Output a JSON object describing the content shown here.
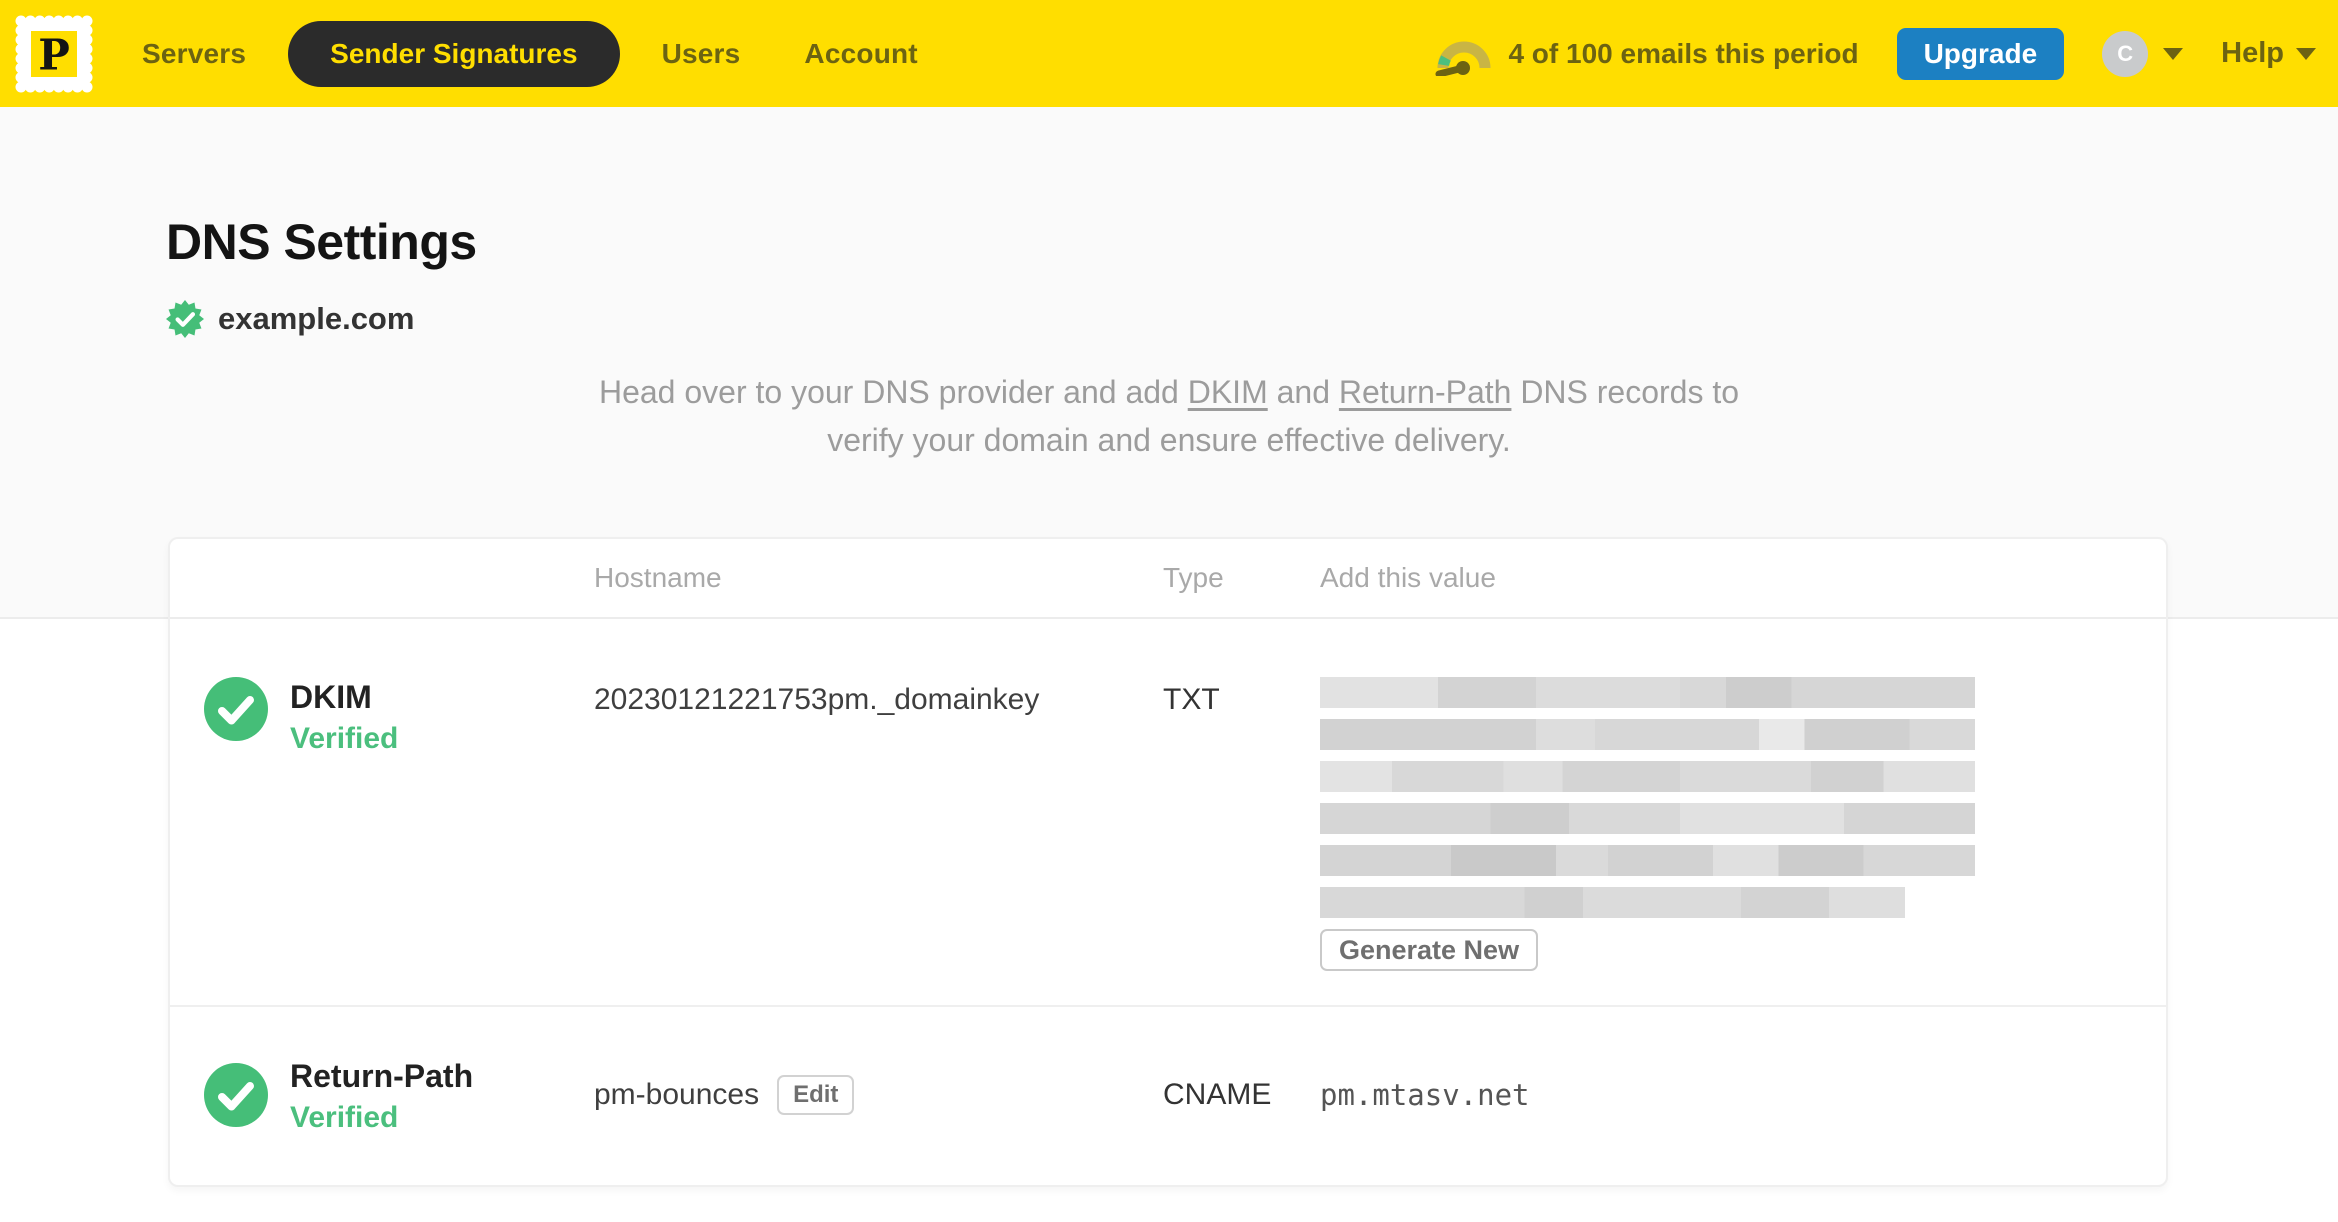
{
  "brand": {
    "logo_letter": "P",
    "brand_yellow": "#FFDE00",
    "accent_blue": "#1C80C2",
    "accent_green": "#45BE78",
    "nav_text_olive": "#6C6312"
  },
  "nav": {
    "items": [
      {
        "label": "Servers",
        "active": false
      },
      {
        "label": "Sender Signatures",
        "active": true
      },
      {
        "label": "Users",
        "active": false
      },
      {
        "label": "Account",
        "active": false
      }
    ],
    "usage_text": "4 of 100 emails this period",
    "upgrade_label": "Upgrade",
    "avatar_initial": "C",
    "help_label": "Help"
  },
  "page": {
    "title": "DNS Settings",
    "domain": "example.com",
    "intro": {
      "pre": "Head over to your DNS provider and add ",
      "link_dkim": "DKIM",
      "mid": " and ",
      "link_return_path": "Return-Path",
      "post": " DNS records to",
      "line2": "verify your domain and ensure effective delivery."
    }
  },
  "table": {
    "headers": {
      "hostname": "Hostname",
      "type": "Type",
      "value": "Add this value"
    },
    "rows": [
      {
        "name": "DKIM",
        "status": "Verified",
        "hostname": "20230121221753pm._domainkey",
        "type": "TXT",
        "value_redacted": true,
        "redacted_lines": 6,
        "action_label": "Generate New"
      },
      {
        "name": "Return-Path",
        "status": "Verified",
        "hostname": "pm-bounces",
        "edit_label": "Edit",
        "type": "CNAME",
        "value": "pm.mtasv.net"
      }
    ]
  }
}
